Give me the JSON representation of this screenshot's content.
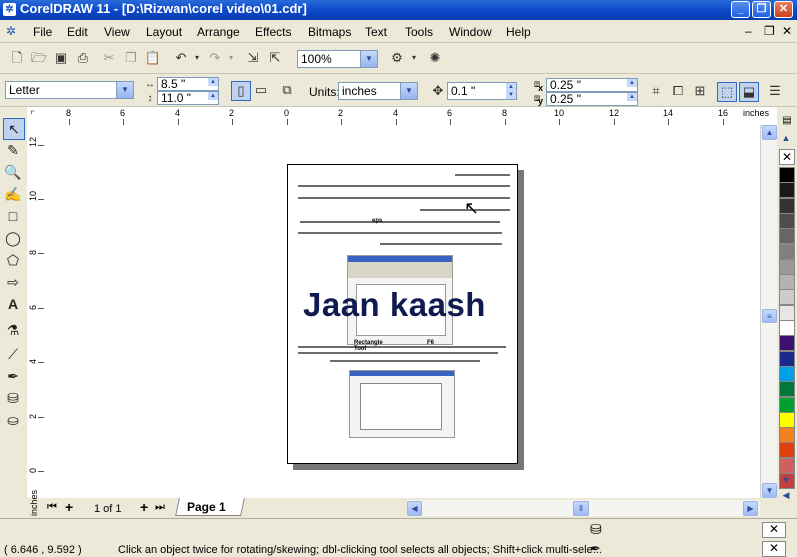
{
  "window": {
    "title": "CorelDRAW 11 - [D:\\Rizwan\\corel video\\01.cdr]",
    "app_icon": "corel-icon"
  },
  "menu": [
    "File",
    "Edit",
    "View",
    "Layout",
    "Arrange",
    "Effects",
    "Bitmaps",
    "Text",
    "Tools",
    "Window",
    "Help"
  ],
  "standard_toolbar": {
    "zoom": "100%"
  },
  "property_bar": {
    "paper_size": "Letter",
    "width": "8.5 \"",
    "height": "11.0 \"",
    "units_label": "Units:",
    "units": "inches",
    "nudge": "0.1 \"",
    "dup_x": "0.25 \"",
    "dup_y": "0.25 \"",
    "x_label": "x",
    "y_label": "y"
  },
  "ruler": {
    "unit": "inches",
    "h_labels": [
      "8",
      "6",
      "4",
      "2",
      "0",
      "2",
      "4",
      "6",
      "8",
      "10",
      "12",
      "14",
      "16"
    ],
    "v_labels": [
      "12",
      "10",
      "8",
      "6",
      "4",
      "2",
      "0"
    ],
    "v_unit": "inches"
  },
  "document": {
    "heading_text": "Jaan kaash",
    "english_snippet_1": "eps",
    "english_snippet_2": "Rectangle Tool",
    "english_snippet_3": "F6"
  },
  "page_nav": {
    "count": "1 of 1",
    "tab": "Page 1"
  },
  "status": {
    "coords": "( 6.646 , 9.592 )",
    "hint": "Click an object twice for rotating/skewing; dbl-clicking tool selects all objects; Shift+click multi-sele..."
  },
  "palette_colors": [
    "#ffffff",
    "#000000",
    "#1a1a1a",
    "#333333",
    "#4d4d4d",
    "#666666",
    "#808080",
    "#999999",
    "#b3b3b3",
    "#cccccc",
    "#e6e6e6",
    "#ffffff",
    "#3d1070",
    "#1a2a8c",
    "#00a0e8",
    "#00783c",
    "#00a030",
    "#ffff00",
    "#f08020",
    "#e04010",
    "#d06060",
    "#c04040"
  ]
}
